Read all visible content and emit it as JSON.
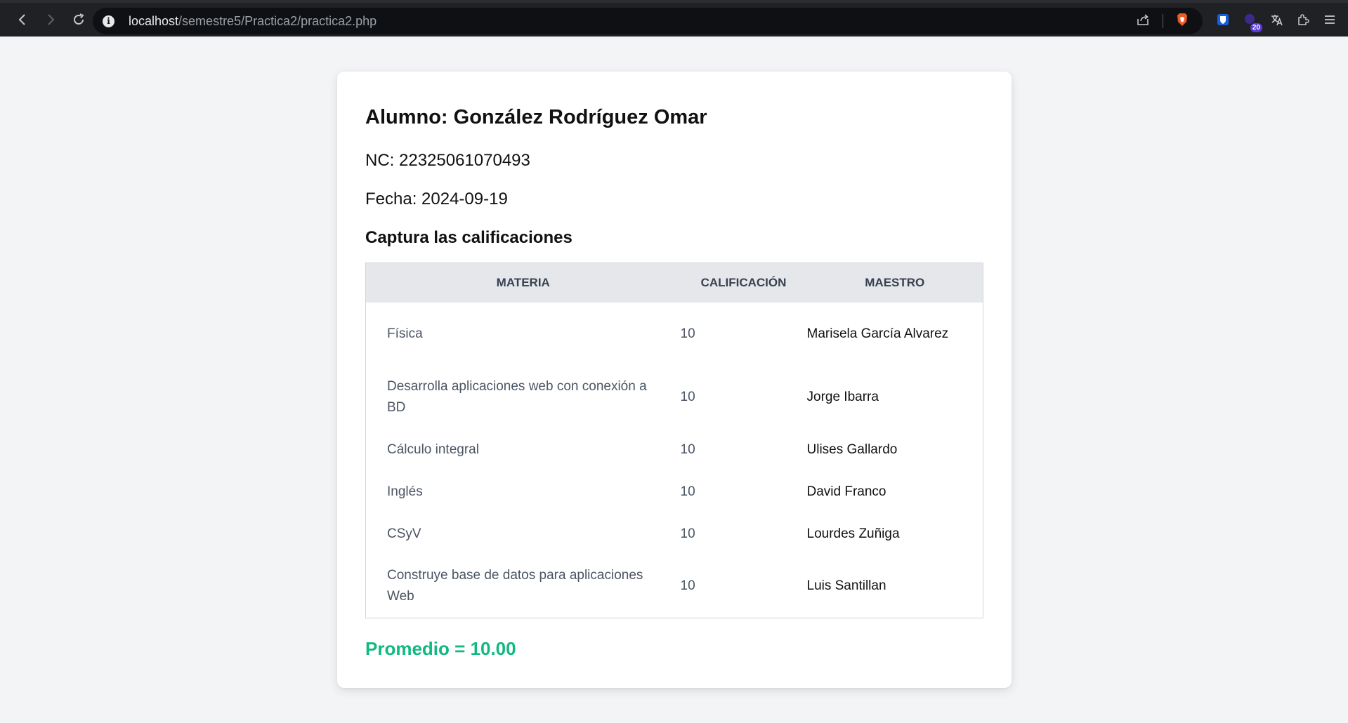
{
  "browser": {
    "url_host": "localhost",
    "url_path": "/semestre5/Practica2/practica2.php",
    "extension_badge": "20"
  },
  "page": {
    "student_line": "Alumno: González Rodríguez Omar",
    "nc_line": "NC: 22325061070493",
    "date_line": "Fecha: 2024-09-19",
    "section_title": "Captura las calificaciones",
    "table": {
      "headers": [
        "MATERIA",
        "CALIFICACIÓN",
        "MAESTRO"
      ],
      "rows": [
        {
          "materia": "Física",
          "calificacion": "10",
          "maestro": "Marisela García Alvarez"
        },
        {
          "materia": "Desarrolla aplicaciones web con conexión a BD",
          "calificacion": "10",
          "maestro": "Jorge Ibarra"
        },
        {
          "materia": "Cálculo integral",
          "calificacion": "10",
          "maestro": "Ulises Gallardo"
        },
        {
          "materia": "Inglés",
          "calificacion": "10",
          "maestro": "David Franco"
        },
        {
          "materia": "CSyV",
          "calificacion": "10",
          "maestro": "Lourdes Zuñiga"
        },
        {
          "materia": "Construye base de datos para aplicaciones Web",
          "calificacion": "10",
          "maestro": "Luis Santillan"
        }
      ]
    },
    "average_line": "Promedio = 10.00"
  },
  "colors": {
    "accent_green": "#10b981",
    "page_bg": "#f3f4f6",
    "header_bg": "#e5e7eb"
  }
}
